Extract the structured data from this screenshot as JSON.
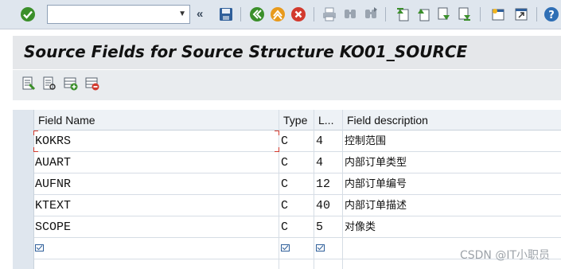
{
  "toolbar": {
    "command_value": "",
    "icons": [
      "ok-checkmark-icon",
      "command-dropdown-icon",
      "collapse-icon",
      "save-icon",
      "back-icon",
      "exit-icon",
      "cancel-icon",
      "print-icon",
      "find-icon",
      "find-next-icon",
      "first-page-icon",
      "prev-page-icon",
      "next-page-icon",
      "last-page-icon",
      "new-session-icon",
      "shortcut-icon",
      "help-icon"
    ]
  },
  "title": "Source Fields for Source Structure KO01_SOURCE",
  "app_toolbar": {
    "icons": [
      "display-change-icon",
      "details-icon",
      "insert-row-icon",
      "delete-row-icon"
    ]
  },
  "table": {
    "columns": [
      "Field Name",
      "Type",
      "L...",
      "Field description"
    ],
    "rows": [
      {
        "field": "KOKRS",
        "type": "C",
        "len": "4",
        "desc": "控制范围"
      },
      {
        "field": "AUART",
        "type": "C",
        "len": "4",
        "desc": "内部订单类型"
      },
      {
        "field": "AUFNR",
        "type": "C",
        "len": "12",
        "desc": "内部订单编号"
      },
      {
        "field": "KTEXT",
        "type": "C",
        "len": "40",
        "desc": "内部订单描述"
      },
      {
        "field": "SCOPE",
        "type": "C",
        "len": "5",
        "desc": "对像类"
      }
    ]
  },
  "watermark": "CSDN @IT小职员",
  "colors": {
    "toolbar_bg": "#dfe6ee",
    "title_bg": "#e5e7ea",
    "header_bg": "#eef2f6",
    "check_icon": "#3b8f2a",
    "focus": "#d23a2e"
  }
}
